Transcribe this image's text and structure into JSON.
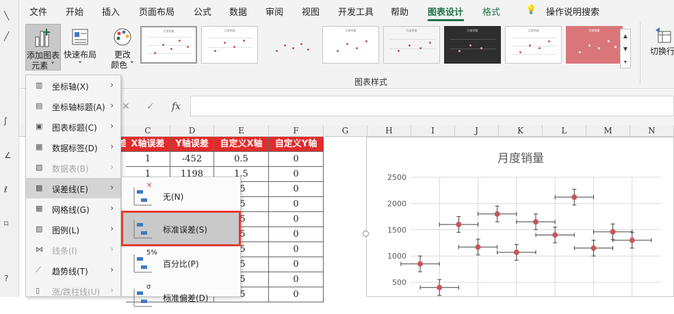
{
  "menubar": {
    "tabs": [
      "文件",
      "开始",
      "插入",
      "页面布局",
      "公式",
      "数据",
      "审阅",
      "视图",
      "开发工具",
      "帮助",
      "图表设计",
      "格式"
    ],
    "active_tab": "图表设计",
    "help_search": "操作说明搜索"
  },
  "ribbon": {
    "add_element": "添加图表\n元素",
    "add_element_l1": "添加图表",
    "add_element_l2": "元素 ˅",
    "quick_layout_l1": "快速布局",
    "quick_layout_l2": "˅",
    "change_color_l1": "更改",
    "change_color_l2": "颜色 ˅",
    "styles_group_label": "图表样式",
    "thumb_title": "月度销量",
    "switch_row_col": "切换行/"
  },
  "formula_bar": {
    "cancel": "✕",
    "enter": "✓",
    "fx": "fx"
  },
  "columns": [
    "C",
    "D",
    "E",
    "F",
    "G",
    "H",
    "I",
    "J",
    "K",
    "L",
    "M",
    "N"
  ],
  "table": {
    "headers": [
      "X轴误差",
      "Y轴误差",
      "自定义X轴",
      "自定义Y轴"
    ],
    "partial_header": "差",
    "rows": [
      [
        "1",
        "-452",
        "0.5",
        "0"
      ],
      [
        "1",
        "1198",
        "1.5",
        "0"
      ],
      [
        "",
        "",
        ".5",
        "0"
      ],
      [
        "",
        "",
        ".5",
        "0"
      ],
      [
        "",
        "",
        ".5",
        "0"
      ],
      [
        "",
        "",
        ".5",
        "0"
      ],
      [
        "",
        "",
        ".5",
        "0"
      ],
      [
        "",
        "",
        ".5",
        "0"
      ],
      [
        "",
        "",
        ".5",
        "0"
      ],
      [
        "",
        "",
        ".5",
        "0"
      ]
    ]
  },
  "menu": {
    "items": [
      {
        "label": "坐标轴(X)",
        "icon": "axes-icon",
        "disabled": false
      },
      {
        "label": "坐标轴标题(A)",
        "icon": "axis-title-icon",
        "disabled": false
      },
      {
        "label": "图表标题(C)",
        "icon": "chart-title-icon",
        "disabled": false
      },
      {
        "label": "数据标签(D)",
        "icon": "data-labels-icon",
        "disabled": false
      },
      {
        "label": "数据表(B)",
        "icon": "data-table-icon",
        "disabled": true
      },
      {
        "label": "误差线(E)",
        "icon": "error-bars-icon",
        "disabled": false
      },
      {
        "label": "网格线(G)",
        "icon": "gridlines-icon",
        "disabled": false
      },
      {
        "label": "图例(L)",
        "icon": "legend-icon",
        "disabled": false
      },
      {
        "label": "线条(I)",
        "icon": "lines-icon",
        "disabled": true
      },
      {
        "label": "趋势线(T)",
        "icon": "trendline-icon",
        "disabled": false
      },
      {
        "label": "涨/跌柱线(U)",
        "icon": "up-down-bars-icon",
        "disabled": true
      }
    ]
  },
  "submenu": {
    "items": [
      {
        "label": "无(N)",
        "badge": "✕"
      },
      {
        "label": "标准误差(S)",
        "badge": ""
      },
      {
        "label": "百分比(P)",
        "badge": "5%"
      },
      {
        "label": "标准偏差(D)",
        "badge": "σ"
      }
    ]
  },
  "colors": {
    "accent": "#1f7244",
    "header_red": "#e32b2b",
    "marker": "#c7575a",
    "highlight": "#e33b2f"
  },
  "chart_data": {
    "type": "scatter",
    "title": "月度销量",
    "ylim": [
      0,
      2500
    ],
    "yticks": [
      "2500",
      "2000",
      "1500",
      "1000",
      "500"
    ],
    "points": [
      {
        "x": 1,
        "y": 850
      },
      {
        "x": 2,
        "y": 400
      },
      {
        "x": 3,
        "y": 1600
      },
      {
        "x": 4,
        "y": 1170
      },
      {
        "x": 5,
        "y": 1800
      },
      {
        "x": 6,
        "y": 1070
      },
      {
        "x": 7,
        "y": 1650
      },
      {
        "x": 8,
        "y": 1400
      },
      {
        "x": 9,
        "y": 2120
      },
      {
        "x": 10,
        "y": 1150
      },
      {
        "x": 11,
        "y": 1460
      },
      {
        "x": 12,
        "y": 1300
      }
    ],
    "x_error": 1,
    "y_error": 150,
    "grid": true
  }
}
